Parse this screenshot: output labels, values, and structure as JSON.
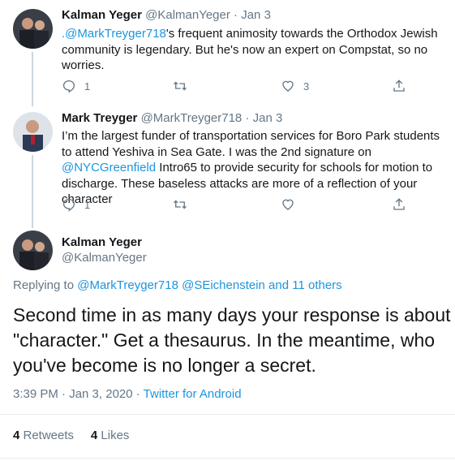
{
  "tweet1": {
    "name": "Kalman Yeger",
    "handle": "@KalmanYeger",
    "dot": "·",
    "date": "Jan 3",
    "text_link": ".@MarkTreyger718",
    "text_rest": "'s frequent animosity towards the Orthodox Jewish community is legendary.  But he's now an expert on Compstat, so no worries.",
    "reply_count": "1",
    "like_count": "3"
  },
  "tweet2": {
    "name": "Mark Treyger",
    "handle": "@MarkTreyger718",
    "dot": "·",
    "date": "Jan 3",
    "text_part1": "I’m the largest funder of transportation services for Boro Park students to attend Yeshiva in Sea Gate. I was the 2nd signature on ",
    "text_link": "@NYCGreenfield",
    "text_part2": " Intro65 to provide security for schools for motion to discharge. These baseless attacks are more of a reflection of your character",
    "reply_count": "1"
  },
  "main": {
    "name": "Kalman Yeger",
    "handle": "@KalmanYeger",
    "replying_prefix": "Replying to ",
    "replying_to": "@MarkTreyger718 @SEichenstein and 11 others",
    "text": "Second time in as many days your response is about \"character.\"  Get a thesaurus.  In the meantime, who you've become is no longer a secret.",
    "timestamp": "3:39 PM · Jan 3, 2020 · ",
    "source": "Twitter for Android",
    "retweet_count": "4",
    "retweet_label": " Retweets",
    "like_count": "4",
    "like_label": " Likes"
  },
  "colors": {
    "link": "#1b95e0",
    "secondary": "#657786",
    "text": "#14171a"
  }
}
